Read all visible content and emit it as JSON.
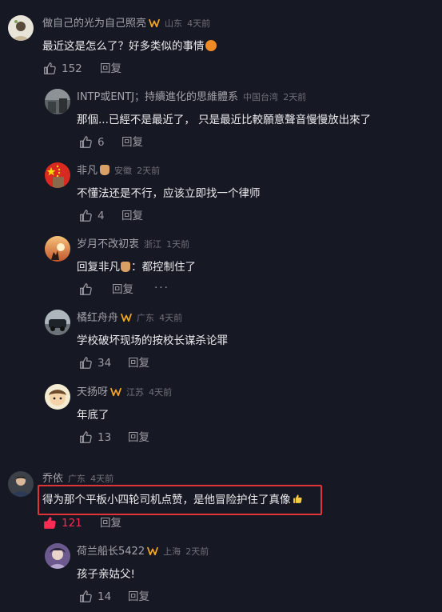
{
  "colors": {
    "background": "#161823",
    "highlight_border": "#e0343a",
    "liked_red": "#fe2c55",
    "muted_text": "#9a9ba3",
    "badge_orange": "#f5a623"
  },
  "comments": [
    {
      "username": "做自己的光为自己照亮",
      "location": "山东",
      "time": "4天前",
      "badge": "badge-icon",
      "text": "最近这是怎么了？好多类似的事情",
      "emoji": "exploding-head-emoji",
      "likes": "152",
      "reply_label": "回复"
    },
    {
      "username": "INTP或ENTJ；持續進化的思維體系",
      "location": "中国台湾",
      "time": "2天前",
      "text": "那個...已經不是最近了， 只是最近比較願意聲音慢慢放出來了",
      "likes": "6",
      "reply_label": "回复"
    },
    {
      "username": "非凡",
      "username_emoji": "victory-hand-emoji",
      "location": "安徽",
      "time": "2天前",
      "text": "不懂法还是不行，应该立即找一个律师",
      "likes": "4",
      "reply_label": "回复"
    },
    {
      "username": "岁月不改初衷",
      "location": "浙江",
      "time": "1天前",
      "text_prefix": "回复非凡",
      "text": "：都控制住了",
      "likes": "",
      "reply_label": "回复",
      "more": "···"
    },
    {
      "username": "橘红舟舟",
      "location": "广东",
      "time": "4天前",
      "badge": "badge-icon",
      "text": "学校破坏现场的按校长谋杀论罪",
      "likes": "34",
      "reply_label": "回复"
    },
    {
      "username": "天扬呀",
      "location": "江苏",
      "time": "4天前",
      "badge": "badge-icon",
      "text": "年底了",
      "likes": "13",
      "reply_label": "回复"
    },
    {
      "username": "乔依",
      "location": "广东",
      "time": "4天前",
      "text": "得为那个平板小四轮司机点赞，是他冒险护住了真像",
      "emoji": "thumbs-up-emoji",
      "likes": "121",
      "reply_label": "回复"
    },
    {
      "username": "荷兰船长5422",
      "location": "上海",
      "time": "2天前",
      "badge": "badge-icon",
      "text": "孩子亲姑父!",
      "likes": "14",
      "reply_label": "回复"
    }
  ]
}
